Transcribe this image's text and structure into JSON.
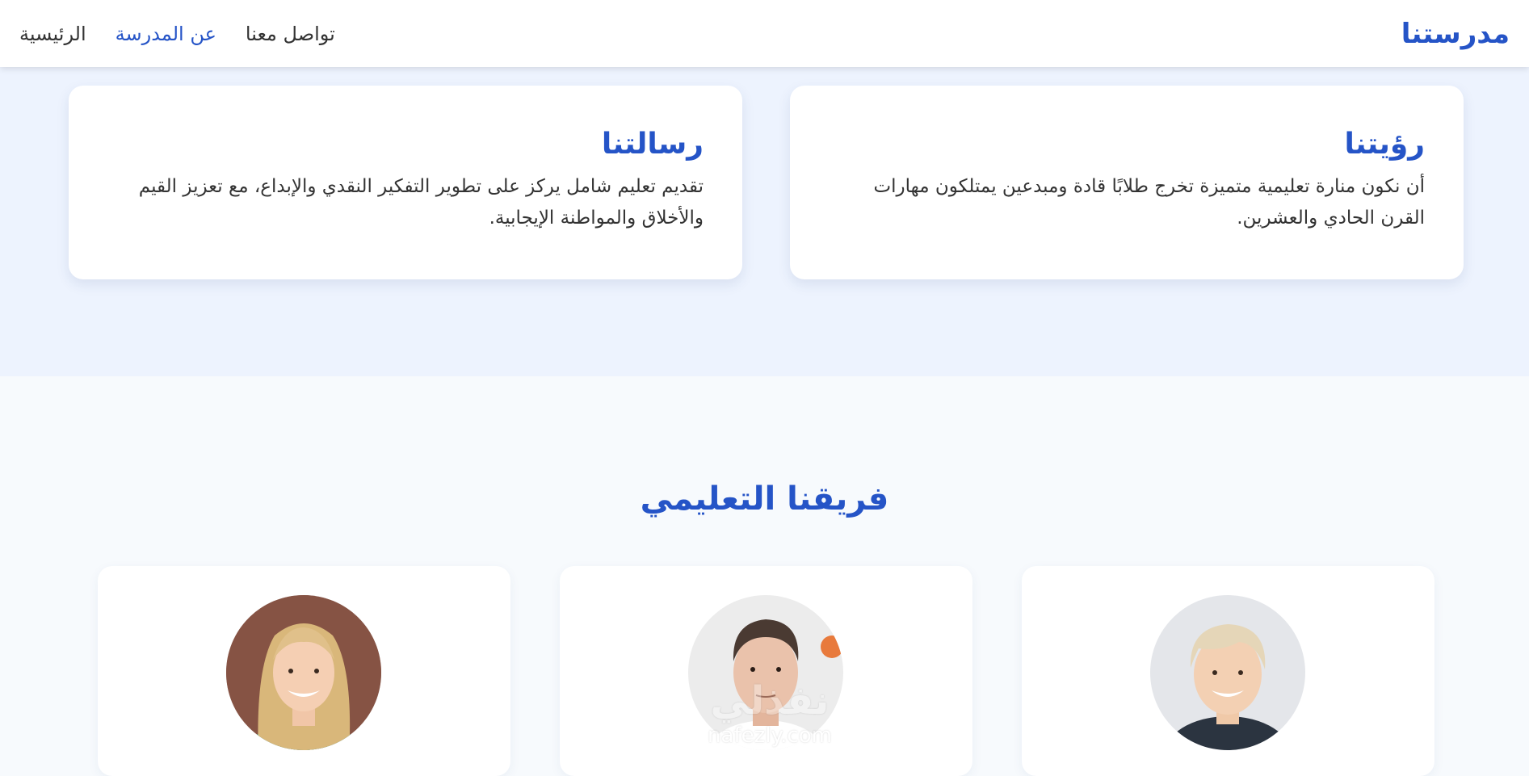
{
  "navbar": {
    "brand": "مدرستنا",
    "links": [
      {
        "label": "الرئيسية",
        "active": false
      },
      {
        "label": "عن المدرسة",
        "active": true
      },
      {
        "label": "تواصل معنا",
        "active": false
      }
    ]
  },
  "about": {
    "vision": {
      "title": "رؤيتنا",
      "text": "أن نكون منارة تعليمية متميزة تخرج طلابًا قادة ومبدعين يمتلكون مهارات القرن الحادي والعشرين."
    },
    "mission": {
      "title": "رسالتنا",
      "text": "تقديم تعليم شامل يركز على تطوير التفكير النقدي والإبداع، مع تعزيز القيم والأخلاق والمواطنة الإيجابية."
    }
  },
  "team": {
    "title": "فريقنا التعليمي",
    "members": [
      {
        "photo": "teacher-photo-short-blonde-hair"
      },
      {
        "photo": "teacher-photo-dark-hair-man"
      },
      {
        "photo": "teacher-photo-long-blonde-hair"
      }
    ]
  },
  "watermark": {
    "arabic": "نفذلي",
    "latin": "nafezly.com"
  },
  "colors": {
    "accent": "#2554c7",
    "about_bg": "#edf3fe",
    "team_bg": "#f7fafd",
    "card_bg": "#ffffff"
  }
}
